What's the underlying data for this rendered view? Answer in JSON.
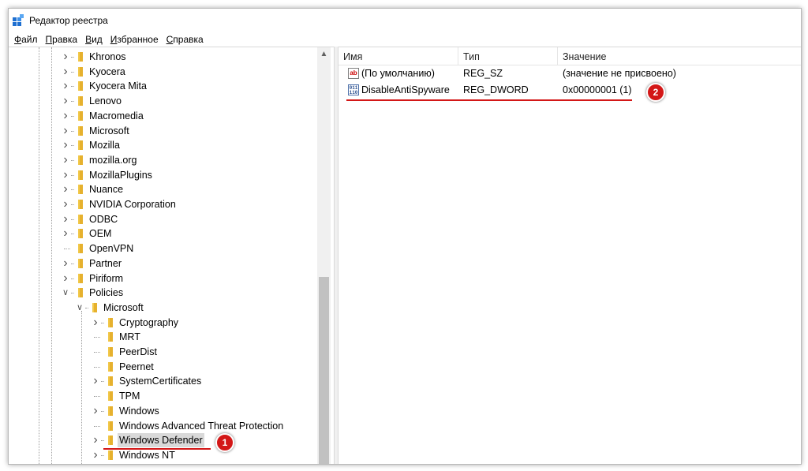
{
  "window": {
    "title": "Редактор реестра",
    "icon": "regedit-icon"
  },
  "menu": [
    {
      "label": "Файл",
      "accel": "Ф",
      "rest": "айл"
    },
    {
      "label": "Правка",
      "accel": "П",
      "rest": "равка"
    },
    {
      "label": "Вид",
      "accel": "В",
      "rest": "ид"
    },
    {
      "label": "Избранное",
      "accel": "И",
      "rest": "збранное"
    },
    {
      "label": "Справка",
      "accel": "С",
      "rest": "правка"
    }
  ],
  "tree": {
    "items": [
      {
        "label": "Khronos",
        "level": 1,
        "expander": "collapsed"
      },
      {
        "label": "Kyocera",
        "level": 1,
        "expander": "collapsed"
      },
      {
        "label": "Kyocera Mita",
        "level": 1,
        "expander": "collapsed"
      },
      {
        "label": "Lenovo",
        "level": 1,
        "expander": "collapsed"
      },
      {
        "label": "Macromedia",
        "level": 1,
        "expander": "collapsed"
      },
      {
        "label": "Microsoft",
        "level": 1,
        "expander": "collapsed"
      },
      {
        "label": "Mozilla",
        "level": 1,
        "expander": "collapsed"
      },
      {
        "label": "mozilla.org",
        "level": 1,
        "expander": "collapsed"
      },
      {
        "label": "MozillaPlugins",
        "level": 1,
        "expander": "collapsed"
      },
      {
        "label": "Nuance",
        "level": 1,
        "expander": "collapsed"
      },
      {
        "label": "NVIDIA Corporation",
        "level": 1,
        "expander": "collapsed"
      },
      {
        "label": "ODBC",
        "level": 1,
        "expander": "collapsed"
      },
      {
        "label": "OEM",
        "level": 1,
        "expander": "collapsed"
      },
      {
        "label": "OpenVPN",
        "level": 1,
        "expander": "none"
      },
      {
        "label": "Partner",
        "level": 1,
        "expander": "collapsed"
      },
      {
        "label": "Piriform",
        "level": 1,
        "expander": "collapsed"
      },
      {
        "label": "Policies",
        "level": 1,
        "expander": "expanded"
      },
      {
        "label": "Microsoft",
        "level": 2,
        "expander": "expanded"
      },
      {
        "label": "Cryptography",
        "level": 3,
        "expander": "collapsed"
      },
      {
        "label": "MRT",
        "level": 3,
        "expander": "none"
      },
      {
        "label": "PeerDist",
        "level": 3,
        "expander": "none"
      },
      {
        "label": "Peernet",
        "level": 3,
        "expander": "none"
      },
      {
        "label": "SystemCertificates",
        "level": 3,
        "expander": "collapsed"
      },
      {
        "label": "TPM",
        "level": 3,
        "expander": "none"
      },
      {
        "label": "Windows",
        "level": 3,
        "expander": "collapsed"
      },
      {
        "label": "Windows Advanced Threat Protection",
        "level": 3,
        "expander": "none"
      },
      {
        "label": "Windows Defender",
        "level": 3,
        "expander": "collapsed",
        "selected": true
      },
      {
        "label": "Windows NT",
        "level": 3,
        "expander": "collapsed"
      }
    ]
  },
  "list": {
    "columns": [
      "Имя",
      "Тип",
      "Значение"
    ],
    "rows": [
      {
        "name": "(По умолчанию)",
        "type": "REG_SZ",
        "value": "(значение не присвоено)",
        "icon": "string-value-icon",
        "icon_text": "ab"
      },
      {
        "name": "DisableAntiSpyware",
        "type": "REG_DWORD",
        "value": "0x00000001 (1)",
        "icon": "binary-value-icon",
        "icon_text": "011\n110"
      }
    ]
  },
  "annotations": {
    "badge1": "1",
    "badge2": "2",
    "color": "#d31717"
  }
}
